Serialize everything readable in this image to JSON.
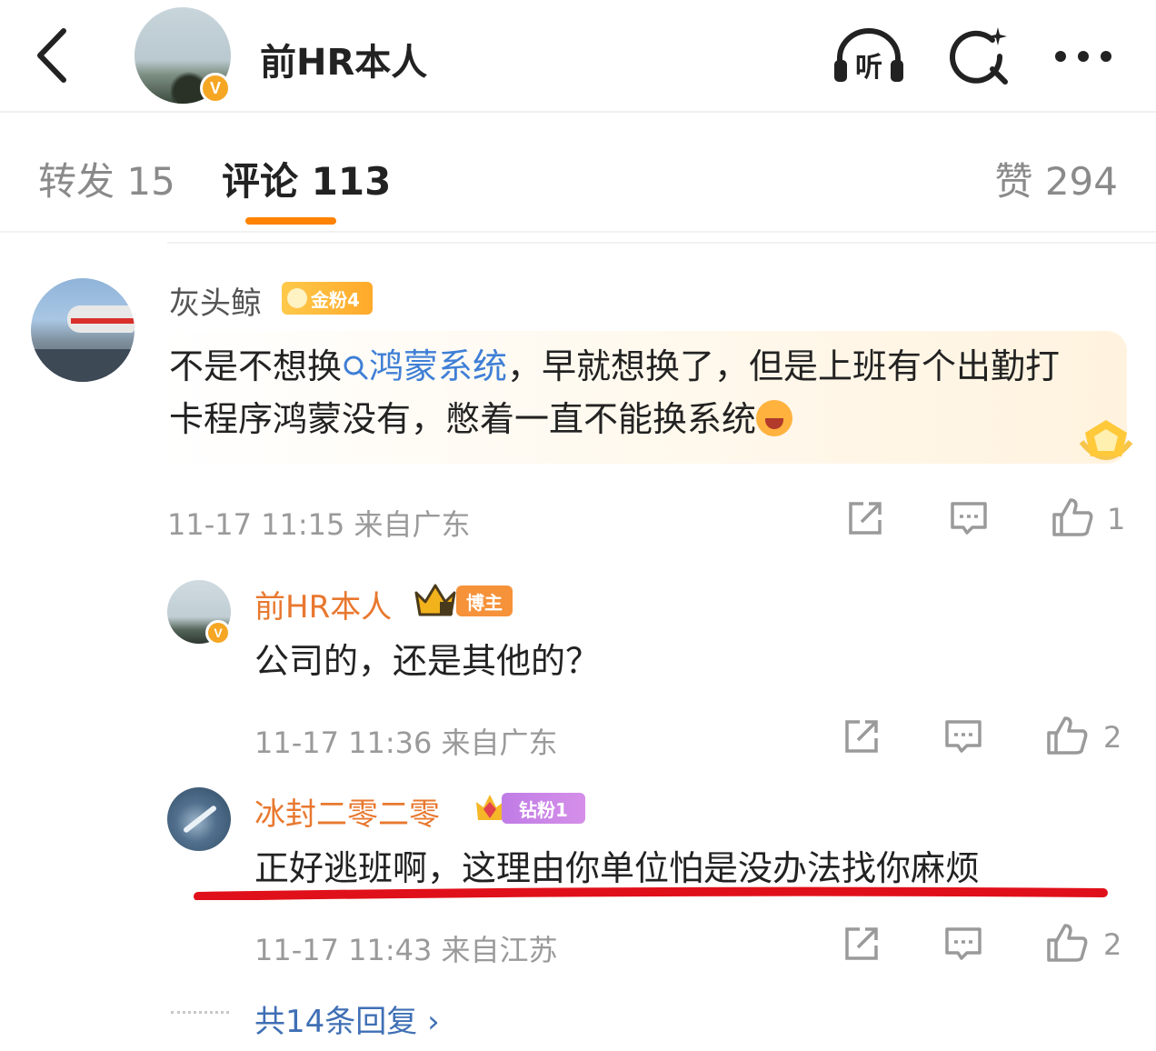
{
  "header": {
    "title": "前HR本人",
    "badge": "V"
  },
  "tabs": {
    "repost": "转发 15",
    "comment": "评论 113",
    "like": "赞 294"
  },
  "comments": [
    {
      "name": "灰头鲸",
      "badge": "金粉4",
      "text_before": "不是不想换",
      "link": "鸿蒙系统",
      "text_after": "，早就想换了，但是上班有个出勤打卡程序鸿蒙没有，憋着一直不能换系统",
      "time": "11-17 11:15",
      "location": "来自广东",
      "likes": "1"
    },
    {
      "name": "前HR本人",
      "badge": "博主",
      "badge_v": "V",
      "text": "公司的，还是其他的？",
      "time": "11-17 11:36",
      "location": "来自广东",
      "likes": "2"
    },
    {
      "name": "冰封二零二零",
      "badge": "钻粉1",
      "text": "正好逃班啊，这理由你单位怕是没办法找你麻烦",
      "time": "11-17 11:43",
      "location": "来自江苏",
      "likes": "2"
    }
  ],
  "more_replies": "共14条回复 ›",
  "colors": {
    "accent": "#ff8200",
    "link": "#3f7fd6",
    "name_orange": "#e8782f",
    "underline_red": "#e0101a"
  },
  "icons": [
    "back-icon",
    "listen-icon",
    "search-icon",
    "more-icon",
    "share-icon",
    "comment-icon",
    "like-icon"
  ]
}
